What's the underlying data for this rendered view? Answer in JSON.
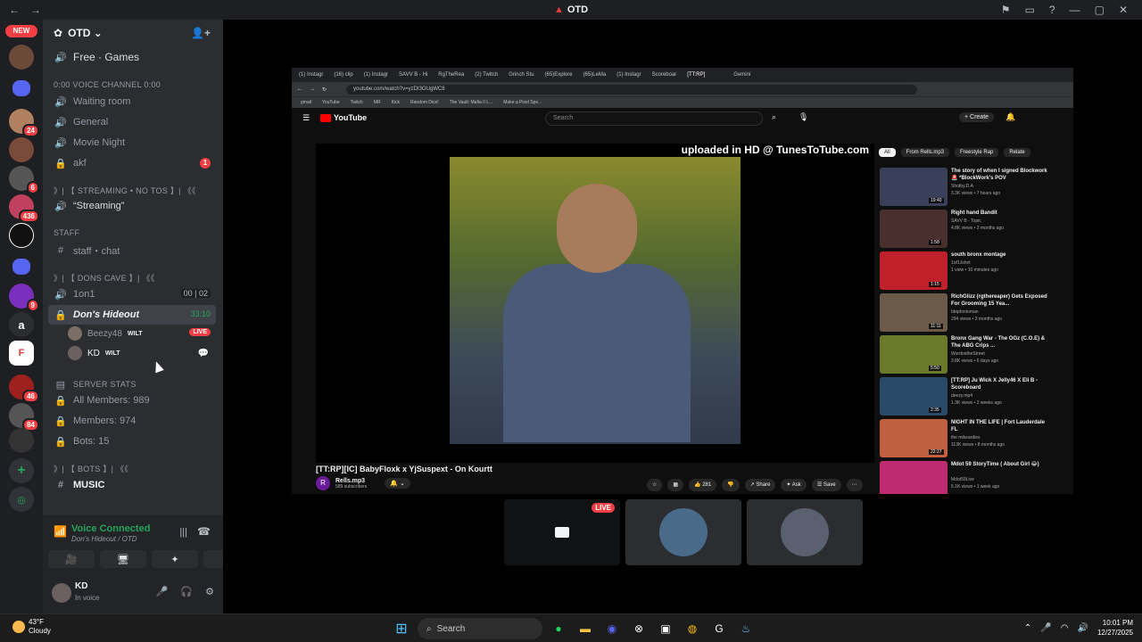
{
  "window": {
    "title": "OTD"
  },
  "guilds": {
    "new_label": "NEW",
    "badges": [
      "24",
      "6",
      "436",
      "9",
      "46",
      "84"
    ],
    "letter": "a"
  },
  "server": {
    "name": "OTD"
  },
  "channels": [
    {
      "icon": "volume-icon",
      "label": "Free · Games",
      "type": "voice"
    },
    {
      "label": "0:00 VOICE CHANNEL 0:00",
      "type": "category"
    },
    {
      "label": "Waiting room",
      "type": "voice"
    },
    {
      "label": "General",
      "type": "voice"
    },
    {
      "label": "Movie Night",
      "type": "voice"
    },
    {
      "label": "akf",
      "type": "locked",
      "badge": "1"
    },
    {
      "label": "》| 【 STREAMING • NO TOS 】| 《《",
      "type": "category"
    },
    {
      "label": "“Streaming”",
      "type": "voice"
    },
    {
      "label": "STAFF",
      "type": "category"
    },
    {
      "label": "staff・chat",
      "type": "text"
    },
    {
      "label": "》| 【 DONS CAVE 】| 《《",
      "type": "category"
    },
    {
      "label": "1on1",
      "type": "voice",
      "counter": "00 | 02"
    },
    {
      "label": "Don's Hideout",
      "type": "locked",
      "timer": "33:10"
    },
    {
      "label": "SERVER STATS",
      "type": "category"
    },
    {
      "label": "All Members: 989",
      "type": "locked"
    },
    {
      "label": "Members: 974",
      "type": "locked"
    },
    {
      "label": "Bots: 15",
      "type": "locked"
    },
    {
      "label": "》| 【 BOTS 】| 《《",
      "type": "category"
    },
    {
      "label": "MUSIC",
      "type": "text"
    }
  ],
  "voice_users": [
    {
      "name": "Beezy48",
      "tag": "WILT",
      "live": "LIVE"
    },
    {
      "name": "KD",
      "tag": "WILT"
    }
  ],
  "voice_panel": {
    "title": "Voice Connected",
    "subtitle": "Don's Hideout / OTD"
  },
  "user": {
    "name": "KD",
    "status": "In voice"
  },
  "browser": {
    "tabs": [
      "(1) Instagr",
      "(16) clip",
      "(1) Instagr",
      "SAVV B - Hi",
      "RgTheRea",
      "(2) Twitch",
      "Grinch Stu",
      "(65)Explore",
      "(65)LeMa",
      "(1) Instagr",
      "Scoreboar",
      "[TT:RP]"
    ],
    "gemini": "Gemini",
    "url": "youtube.com/watch?v=yzDt3OUgWC8",
    "bookmarks": [
      "gmail",
      "YouTube",
      "Twitch",
      "MR",
      "Kick",
      "Random Dice!",
      "The Vault: Mafia II L...",
      "Make a Pixel Spe..."
    ]
  },
  "youtube": {
    "logo": "YouTube",
    "search_placeholder": "Search",
    "create": "+ Create",
    "overlay": "uploaded in HD @ TunesToTube.com",
    "video_title": "[TT:RP][IC] BabyFloxk x YjSuspext - On Kourtt",
    "channel": "Rells.mp3",
    "subscribers": "589 subscribers",
    "channel_initial": "R",
    "likes": "281",
    "share": "Share",
    "ask": "Ask",
    "save": "Save",
    "chips": [
      "All",
      "From Rells.mp3",
      "Freestyle Rap",
      "Relate"
    ],
    "recommendations": [
      {
        "title": "The story of when I signed Blockwork 🚨 *BlockWork's POV",
        "channel": "Shotby.D.A",
        "views": "3.3K views • 7 hours ago",
        "duration": "19:40"
      },
      {
        "title": "Right hand Bandit",
        "channel": "SAVV B - Topic",
        "views": "4.8K views • 2 months ago",
        "duration": "1:58"
      },
      {
        "title": "south bronx montage",
        "channel": "1of1Jshot",
        "views": "1 view • 10 minutes ago",
        "duration": "1:15"
      },
      {
        "title": "RichGlizz (rgthereaper) Gets Exposed For Grooming 15 Yea...",
        "channel": "bbqdontoman",
        "views": "294 views • 3 months ago",
        "duration": "11:11"
      },
      {
        "title": "Bronx Gang War - The OGz (C.O.E) & The ABG Crips ...",
        "channel": "WordontheStreet",
        "views": "3.8K views • 6 days ago",
        "duration": "5:50"
      },
      {
        "title": "[TT:RP] Ju Wick X Jelly46 X Eli B - Scoreboard",
        "channel": "deezy.mp4",
        "views": "1.3K views • 2 weeks ago",
        "duration": "2:35"
      },
      {
        "title": "NIGHT IN THE LIFE | Fort Lauderdale FL",
        "channel": "the mikeardies",
        "views": "113K views • 8 months ago",
        "duration": "22:27"
      },
      {
        "title": "Mdot 59 StoryTime ( About Girl 😂)",
        "channel": "Mdot59Live",
        "views": "5.1K views • 1 week ago",
        "duration": ""
      }
    ]
  },
  "stream_tiles": {
    "live": "LIVE"
  },
  "taskbar": {
    "temp": "43°F",
    "weather": "Cloudy",
    "search": "Search",
    "time": "10:01 PM",
    "date": "12/27/2025"
  }
}
